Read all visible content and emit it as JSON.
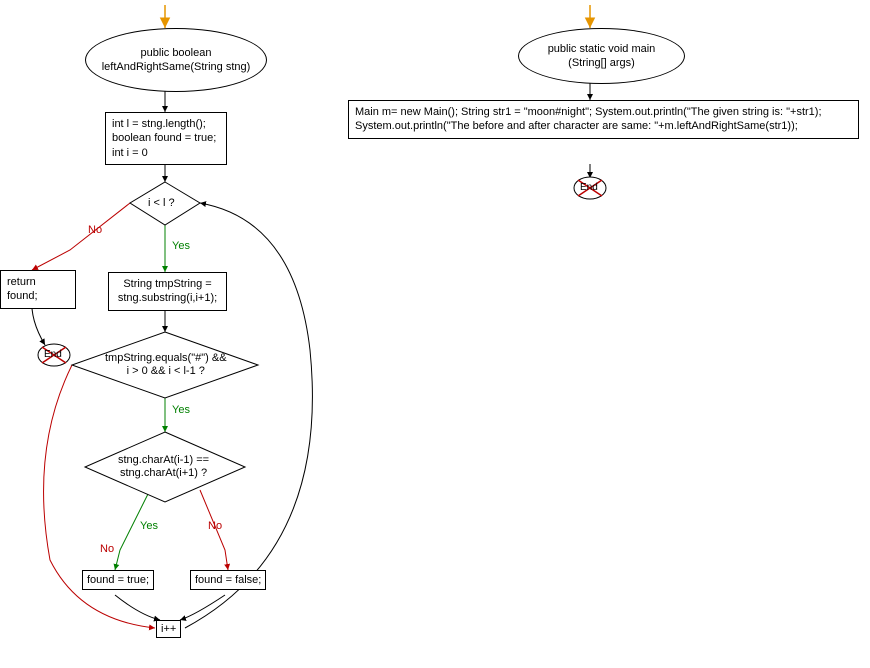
{
  "flowchart_left": {
    "start": "public boolean leftAndRightSame(String stng)",
    "init_box": "int l = stng.length();\nboolean found = true;\nint i = 0",
    "loop_cond": "i < l ?",
    "return_box": "return found;",
    "end_label": "End",
    "tmp_box": "String tmpString =\nstng.substring(i,i+1);",
    "cond_hash": "tmpString.equals(\"#\") &&\ni > 0 && i < l-1 ?",
    "cond_char": "stng.charAt(i-1) ==\nstng.charAt(i+1) ?",
    "found_true": "found = true;",
    "found_false": "found = false;",
    "increment": "i++",
    "labels": {
      "yes": "Yes",
      "no": "No"
    }
  },
  "flowchart_right": {
    "start": "public static void main\n(String[] args)",
    "body": "Main m= new Main();\nString str1 = \"moon#night\";\nSystem.out.println(\"The given string is: \"+str1);\nSystem.out.println(\"The before and after character are same: \"+m.leftAndRightSame(str1));",
    "end_label": "End"
  }
}
